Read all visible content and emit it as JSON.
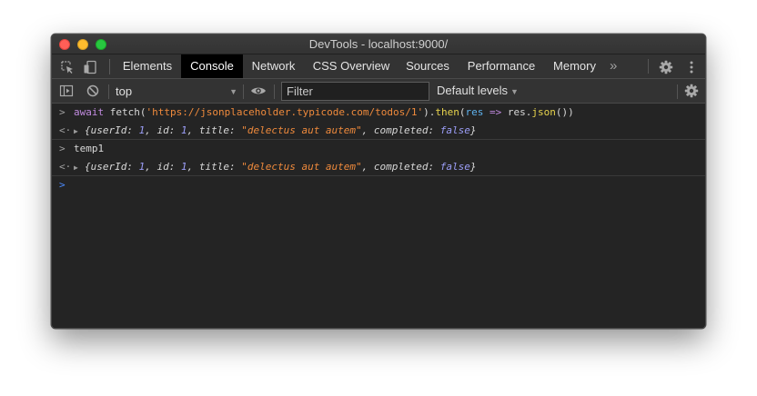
{
  "window": {
    "title": "DevTools - localhost:9000/"
  },
  "tabs": [
    {
      "label": "Elements"
    },
    {
      "label": "Console"
    },
    {
      "label": "Network"
    },
    {
      "label": "CSS Overview"
    },
    {
      "label": "Sources"
    },
    {
      "label": "Performance"
    },
    {
      "label": "Memory"
    }
  ],
  "tabbar": {
    "more_label": "»",
    "active_tab": "Console"
  },
  "toolbar": {
    "context": "top",
    "filter_placeholder": "Filter",
    "levels": "Default levels"
  },
  "console": {
    "command1": {
      "await": "await",
      "fetch": "fetch(",
      "url": "'https://jsonplaceholder.typicode.com/todos/1'",
      "close_dot": ").",
      "then": "then",
      "open": "(",
      "param": "res",
      "arrow": " => ",
      "res2": "res.",
      "json": "json",
      "tail": "())"
    },
    "result": {
      "open": "{",
      "k1": "userId: ",
      "v1": "1",
      "c1": ", ",
      "k2": "id: ",
      "v2": "1",
      "c2": ", ",
      "k3": "title: ",
      "v3": "\"delectus aut autem\"",
      "c3": ", ",
      "k4": "completed: ",
      "v4": "false",
      "close": "}"
    },
    "command2": "temp1"
  },
  "icons": {
    "inspect": "inspect-element-icon",
    "device": "device-toggle-icon",
    "settings": "gear-icon",
    "kebab": "more-vertical-icon",
    "sidebar": "sidebar-toggle-icon",
    "clear": "clear-console-icon",
    "eye": "eye-icon"
  },
  "colors": {
    "background": "#242424",
    "toolbar": "#333333",
    "active_tab": "#000000",
    "string": "#ef8a3c",
    "keyword": "#c08ade",
    "number": "#9c9ef8",
    "function": "#e8d44d",
    "prompt": "#4c8cff"
  }
}
